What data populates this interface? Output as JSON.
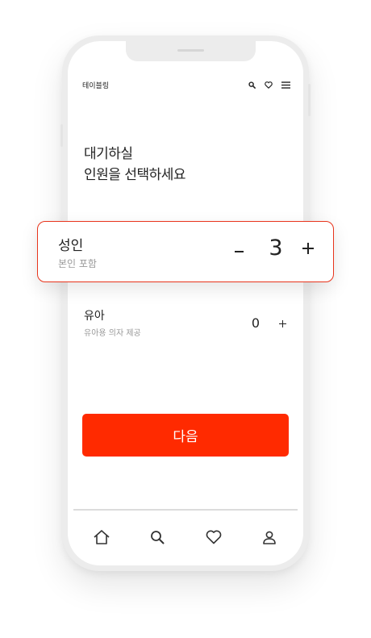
{
  "header": {
    "app_title": "테이블링"
  },
  "icons": {
    "top": [
      "search-icon",
      "heart-icon",
      "menu-icon"
    ],
    "bottom": [
      "home-icon",
      "search-icon",
      "heart-icon",
      "profile-icon"
    ]
  },
  "headline": {
    "line1": "대기하실",
    "line2": "인원을 선택하세요"
  },
  "adult": {
    "label": "성인",
    "sub": "본인 포함",
    "count": "3"
  },
  "infant": {
    "label": "유아",
    "sub": "유아용 의자 제공",
    "count": "0"
  },
  "next_button": {
    "label": "다음"
  },
  "colors": {
    "accent": "#ff2a00",
    "card_border": "#e8341c"
  }
}
